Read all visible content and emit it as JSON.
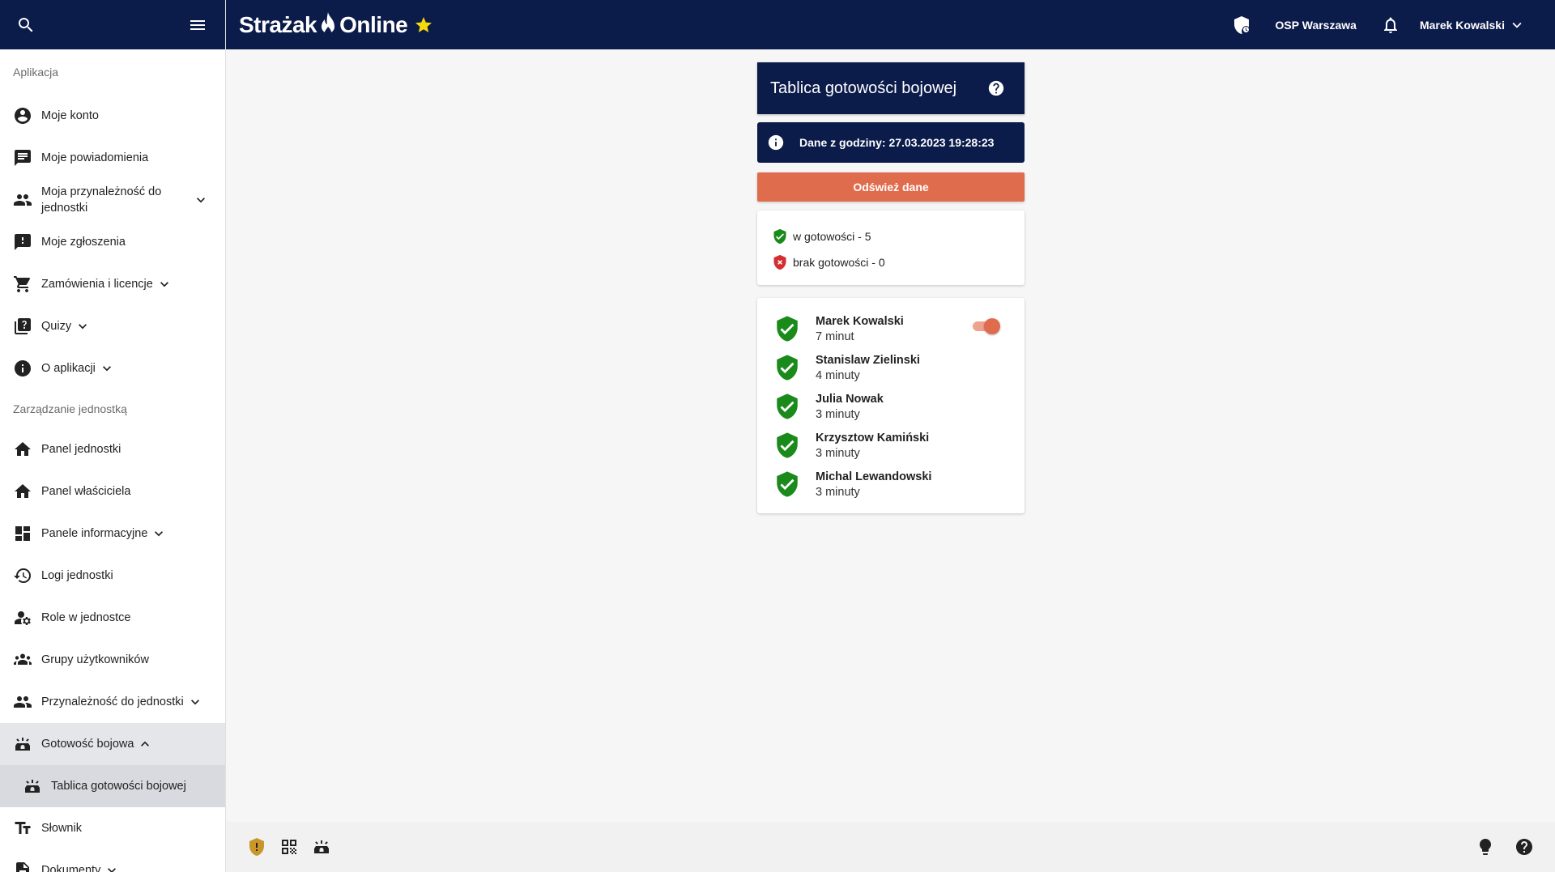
{
  "app": {
    "logo_left": "Strażak",
    "logo_right": "Online"
  },
  "header": {
    "unit_name": "OSP Warszawa",
    "user_name": "Marek Kowalski"
  },
  "sidebar": {
    "sections": [
      {
        "title": "Aplikacja",
        "items": [
          {
            "label": "Moje konto"
          },
          {
            "label": "Moje powiadomienia"
          },
          {
            "label": "Moja przynależność do jednostki"
          },
          {
            "label": "Moje zgłoszenia"
          },
          {
            "label": "Zamówienia i licencje"
          },
          {
            "label": "Quizy"
          },
          {
            "label": "O aplikacji"
          }
        ]
      },
      {
        "title": "Zarządzanie jednostką",
        "items": [
          {
            "label": "Panel jednostki"
          },
          {
            "label": "Panel właściciela"
          },
          {
            "label": "Panele informacyjne"
          },
          {
            "label": "Logi jednostki"
          },
          {
            "label": "Role w jednostce"
          },
          {
            "label": "Grupy użytkowników"
          },
          {
            "label": "Przynależność do jednostki"
          },
          {
            "label": "Gotowość bojowa"
          },
          {
            "label": "Tablica gotowości bojowej"
          },
          {
            "label": "Słownik"
          },
          {
            "label": "Dokumenty"
          }
        ]
      }
    ]
  },
  "main": {
    "title": "Tablica gotowości bojowej",
    "info_text": "Dane z godziny: 27.03.2023 19:28:23",
    "refresh_label": "Odśwież dane",
    "summary": {
      "ready": "w gotowości - 5",
      "not_ready": "brak gotowości - 0"
    },
    "people": [
      {
        "name": "Marek Kowalski",
        "time": "7 minut"
      },
      {
        "name": "Stanislaw Zielinski",
        "time": "4 minuty"
      },
      {
        "name": "Julia Nowak",
        "time": "3 minuty"
      },
      {
        "name": "Krzysztow Kamiński",
        "time": "3 minuty"
      },
      {
        "name": "Michal Lewandowski",
        "time": "3 minuty"
      }
    ],
    "toggle_on": true
  },
  "colors": {
    "navy": "#0b1b4a",
    "accent": "#e06c4e",
    "ready_green": "#1a8a1a",
    "not_ready_red": "#d32f2f",
    "star_yellow": "#f5d90a"
  }
}
